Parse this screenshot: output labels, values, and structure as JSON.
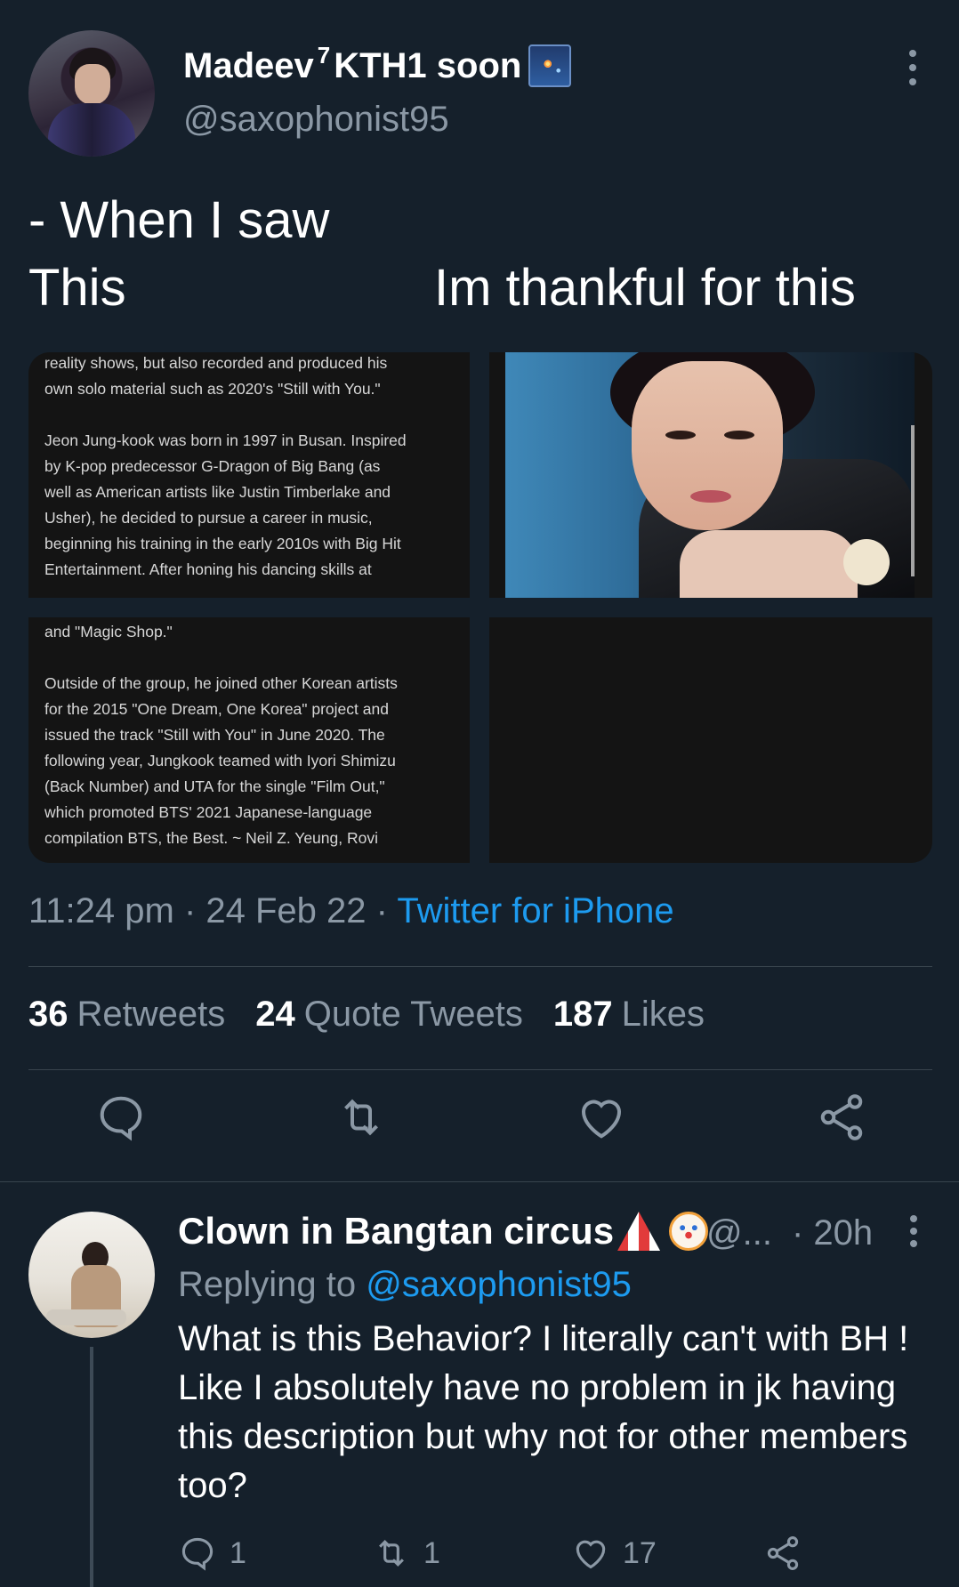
{
  "tweet": {
    "display_name": "Madeev",
    "name_superscript": "7",
    "name_suffix": "KTH1 soon",
    "handle": "@saxophonist95",
    "text_line1": "- When I saw",
    "text_line2": "This",
    "text_right": "Im thankful for this",
    "media": {
      "top_left_text": "reality shows, but also recorded and produced his\nown solo material such as 2020's \"Still with You.\"\n\nJeon Jung-kook was born in 1997 in Busan. Inspired\nby K-pop predecessor G-Dragon of Big Bang (as\nwell as American artists like Justin Timberlake and\nUsher), he decided to pursue a career in music,\nbeginning his training in the early 2010s with Big Hit\nEntertainment. After honing his dancing skills at",
      "bottom_left_text": "and \"Magic Shop.\"\n\nOutside of the group, he joined other Korean artists\nfor the 2015 \"One Dream, One Korea\" project and\nissued the track \"Still with You\" in June 2020. The\nfollowing year, Jungkook teamed with Iyori Shimizu\n(Back Number) and UTA for the single \"Film Out,\"\nwhich promoted BTS' 2021 Japanese-language\ncompilation BTS, the Best. ~ Neil Z. Yeung, Rovi"
    },
    "time": "11:24 pm",
    "date": "24 Feb 22",
    "source": "Twitter for iPhone",
    "stats": {
      "retweets_count": "36",
      "retweets_label": "Retweets",
      "quotes_count": "24",
      "quotes_label": "Quote Tweets",
      "likes_count": "187",
      "likes_label": "Likes"
    }
  },
  "reply": {
    "display_name": "Clown in Bangtan circus",
    "handle": "@...",
    "time": "· 20h",
    "replying_prefix": "Replying to",
    "replying_to": "@saxophonist95",
    "text": "What is this Behavior? I literally can't with BH ! Like I absolutely have no problem in jk having this description but why not for other members too?",
    "counts": {
      "replies": "1",
      "retweets": "1",
      "likes": "17"
    }
  },
  "colors": {
    "background": "#15202b",
    "muted": "#8b98a5",
    "link": "#1d9bf0",
    "divider": "#38444d"
  },
  "icons": [
    "more-vertical-icon",
    "reply-icon",
    "retweet-icon",
    "like-icon",
    "share-icon",
    "fireworks-emoji",
    "circus-tent-emoji",
    "clown-emoji"
  ]
}
